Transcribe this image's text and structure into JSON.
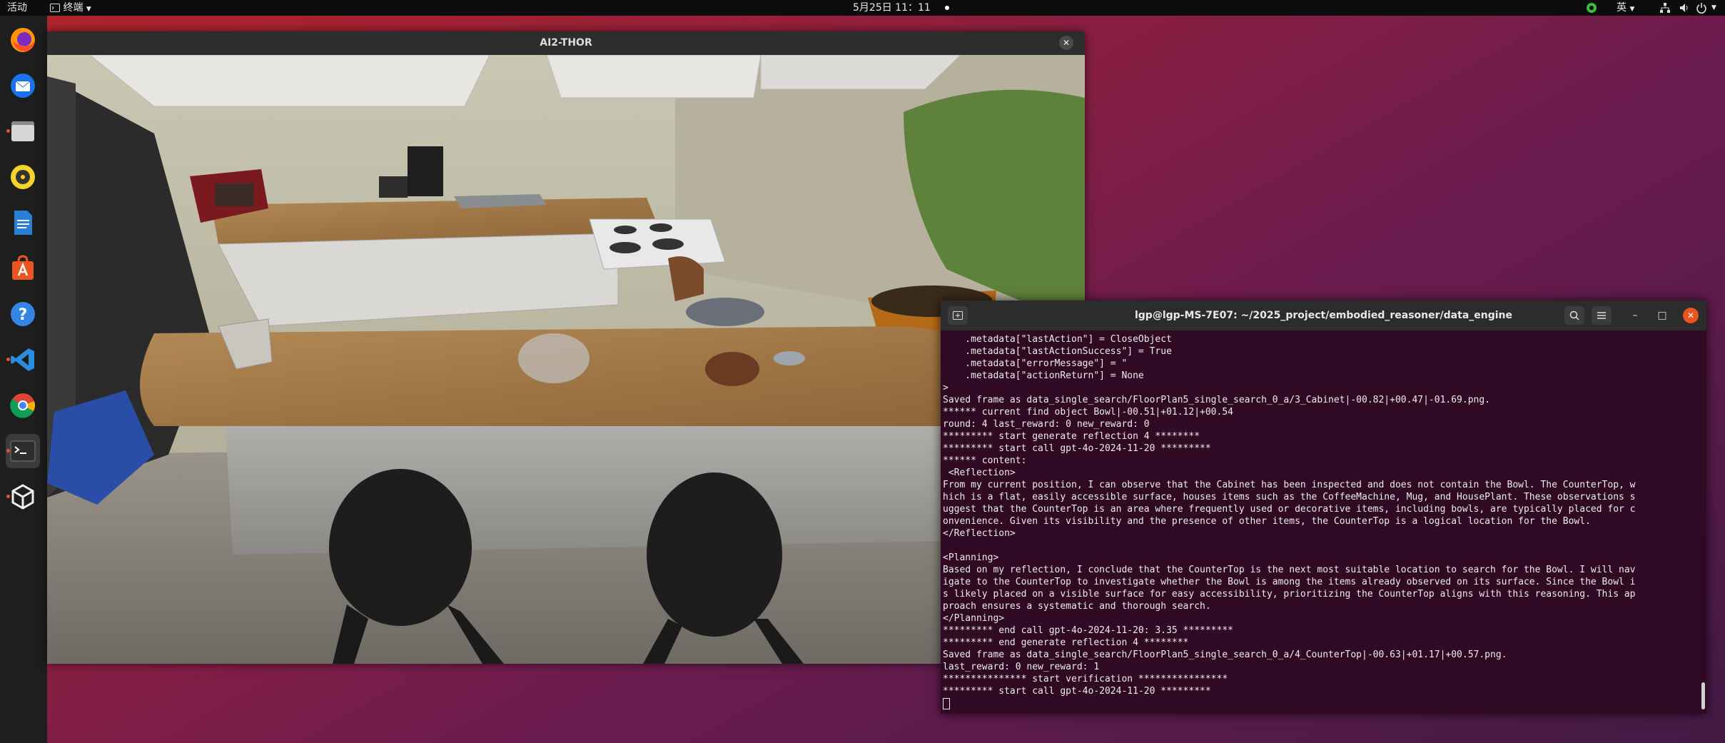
{
  "topbar": {
    "activities": "活动",
    "app_menu": "终端",
    "clock": "5月25日 11：11",
    "input_method": "英"
  },
  "dock": {
    "items": [
      {
        "name": "firefox-icon"
      },
      {
        "name": "thunderbird-icon"
      },
      {
        "name": "files-icon"
      },
      {
        "name": "rhythmbox-icon"
      },
      {
        "name": "writer-icon"
      },
      {
        "name": "software-icon"
      },
      {
        "name": "help-icon"
      },
      {
        "name": "vscode-icon"
      },
      {
        "name": "chrome-icon"
      },
      {
        "name": "terminal-icon"
      },
      {
        "name": "unity-icon"
      }
    ]
  },
  "thor_window": {
    "title": "AI2-THOR"
  },
  "terminal": {
    "title": "lgp@lgp-MS-7E07: ~/2025_project/embodied_reasoner/data_engine",
    "lines": [
      "    .metadata[\"lastAction\"] = CloseObject",
      "    .metadata[\"lastActionSuccess\"] = True",
      "    .metadata[\"errorMessage\"] = \"",
      "    .metadata[\"actionReturn\"] = None",
      ">",
      "Saved frame as data_single_search/FloorPlan5_single_search_0_a/3_Cabinet|-00.82|+00.47|-01.69.png.",
      "****** current find object Bowl|-00.51|+01.12|+00.54",
      "round: 4 last_reward: 0 new_reward: 0",
      "********* start generate reflection 4 ********",
      "********* start call gpt-4o-2024-11-20 *********",
      "****** content:",
      " <Reflection>",
      "From my current position, I can observe that the Cabinet has been inspected and does not contain the Bowl. The CounterTop, w",
      "hich is a flat, easily accessible surface, houses items such as the CoffeeMachine, Mug, and HousePlant. These observations s",
      "uggest that the CounterTop is an area where frequently used or decorative items, including bowls, are typically placed for c",
      "onvenience. Given its visibility and the presence of other items, the CounterTop is a logical location for the Bowl.",
      "</Reflection>",
      "",
      "<Planning>",
      "Based on my reflection, I conclude that the CounterTop is the next most suitable location to search for the Bowl. I will nav",
      "igate to the CounterTop to investigate whether the Bowl is among the items already observed on its surface. Since the Bowl i",
      "s likely placed on a visible surface for easy accessibility, prioritizing the CounterTop aligns with this reasoning. This ap",
      "proach ensures a systematic and thorough search.",
      "</Planning>",
      "********* end call gpt-4o-2024-11-20: 3.35 *********",
      "********* end generate reflection 4 ********",
      "Saved frame as data_single_search/FloorPlan5_single_search_0_a/4_CounterTop|-00.63|+01.17|+00.57.png.",
      "last_reward: 0 new_reward: 1",
      "*************** start verification ****************",
      "********* start call gpt-4o-2024-11-20 *********"
    ]
  }
}
